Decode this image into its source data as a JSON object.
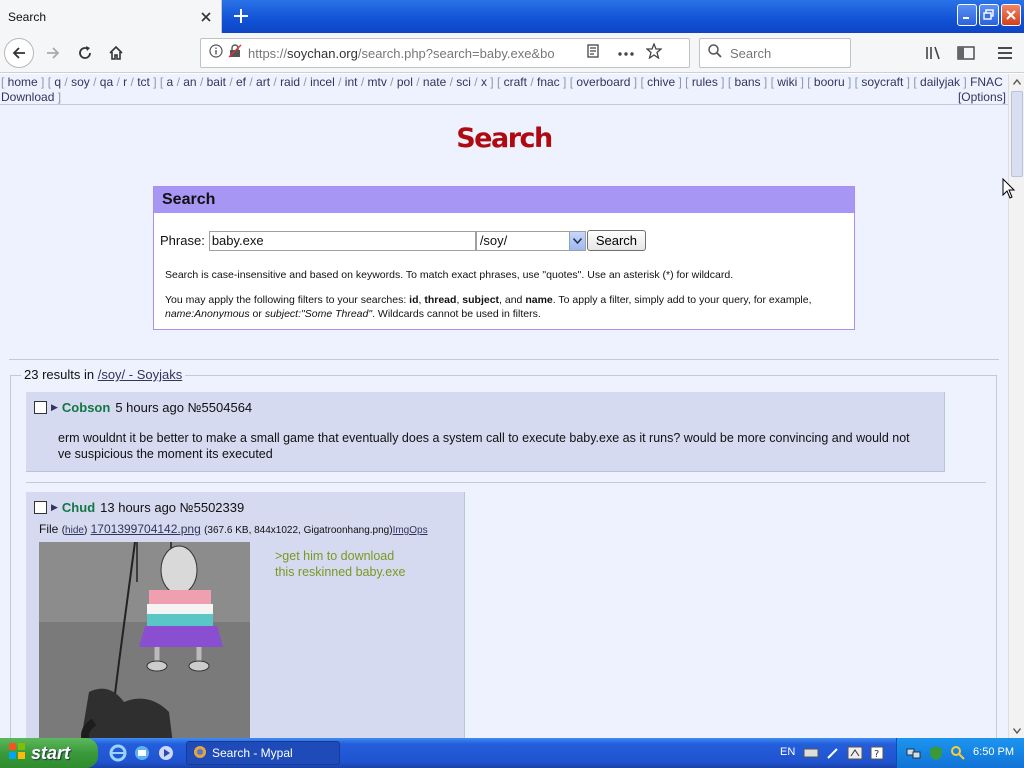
{
  "browser": {
    "tab_title": "Search",
    "url_prefix": "https://",
    "url_domain": "soychan.org",
    "url_path": "/search.php?search=baby.exe&bo",
    "search_placeholder": "Search"
  },
  "topnav": {
    "items": [
      "home",
      "q",
      "soy",
      "qa",
      "r",
      "tct",
      "a",
      "an",
      "bait",
      "ef",
      "art",
      "raid",
      "incel",
      "int",
      "mtv",
      "pol",
      "nate",
      "sci",
      "x",
      "craft",
      "fnac",
      "overboard",
      "chive",
      "rules",
      "bans",
      "wiki",
      "booru",
      "soycraft",
      "dailyjak",
      "FNAC"
    ],
    "line2": "Download",
    "options": "[Options]"
  },
  "page": {
    "title": "Search",
    "box_title": "Search",
    "phrase_label": "Phrase:",
    "phrase_value": "baby.exe",
    "board_value": "/soy/",
    "search_button": "Search",
    "help1": "Search is case-insensitive and based on keywords. To match exact phrases, use \"quotes\". Use an asterisk (*) for wildcard.",
    "help2_a": "You may apply the following filters to your searches: ",
    "help2_b": "id",
    "help2_c": "thread",
    "help2_d": "subject",
    "help2_e": "name",
    "help2_f": ". To apply a filter, simply add to your query, for example, ",
    "help2_g": "name:Anonymous",
    "help2_h": " or ",
    "help2_i": "subject:\"Some Thread\"",
    "help2_j": ". Wildcards cannot be used in filters."
  },
  "results": {
    "count_text": "23 results in",
    "board_link": "/soy/ - Soyjaks",
    "posts": [
      {
        "name": "Cobson",
        "time": "5 hours ago",
        "number": "№5504564",
        "body": "erm wouldnt it be better to make a small game that eventually does a system call to execute baby.exe as it runs? would be more convincing and would not ve suspicious the moment its executed"
      },
      {
        "name": "Chud",
        "time": "13 hours ago",
        "number": "№5502339",
        "file_label": "File",
        "hide": "hide",
        "filename": "1701399704142.png",
        "fileinfo": "(367.6 KB, 844x1022, Gigatroonhang.png)",
        "imgops": "ImgOps",
        "greentext1": ">get him to download",
        "greentext2": "this reskinned baby.exe"
      }
    ]
  },
  "taskbar": {
    "start": "start",
    "task_item": "Search - Mypal",
    "lang": "EN",
    "clock": "6:50 PM"
  },
  "colors": {
    "title_red": "#af0a0f",
    "post_bg": "#d6daf0",
    "name_green": "#117743",
    "greentext": "#789922",
    "box_header": "#a896f5"
  }
}
